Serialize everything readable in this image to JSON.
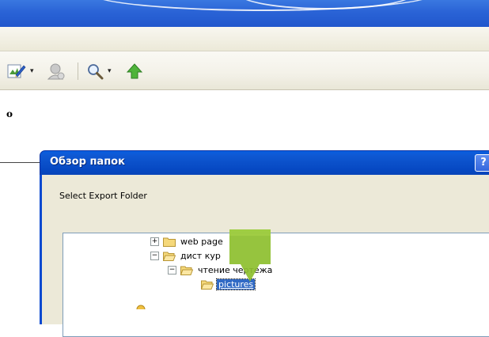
{
  "dialog": {
    "title": "Обзор папок",
    "help_label": "?",
    "prompt": "Select Export Folder",
    "tree": [
      {
        "label": "web page",
        "expander": "+"
      },
      {
        "label": "дист кур",
        "expander": "−"
      },
      {
        "label": "чтение чертежа",
        "expander": "−"
      },
      {
        "label": "pictures",
        "selected": true
      }
    ]
  },
  "page": {
    "letter": "o"
  },
  "toolbar": {
    "icons": [
      "edit-icon",
      "user-icon",
      "search-icon",
      "up-arrow-icon"
    ],
    "dropdown_glyph": "▾"
  },
  "colors": {
    "titlebar": "#2a63d6",
    "dialog_title": "#0648c2",
    "selection": "#316ac5",
    "arrow_green": "#8dbf2e",
    "folder_yellow": "#f5d87a"
  }
}
